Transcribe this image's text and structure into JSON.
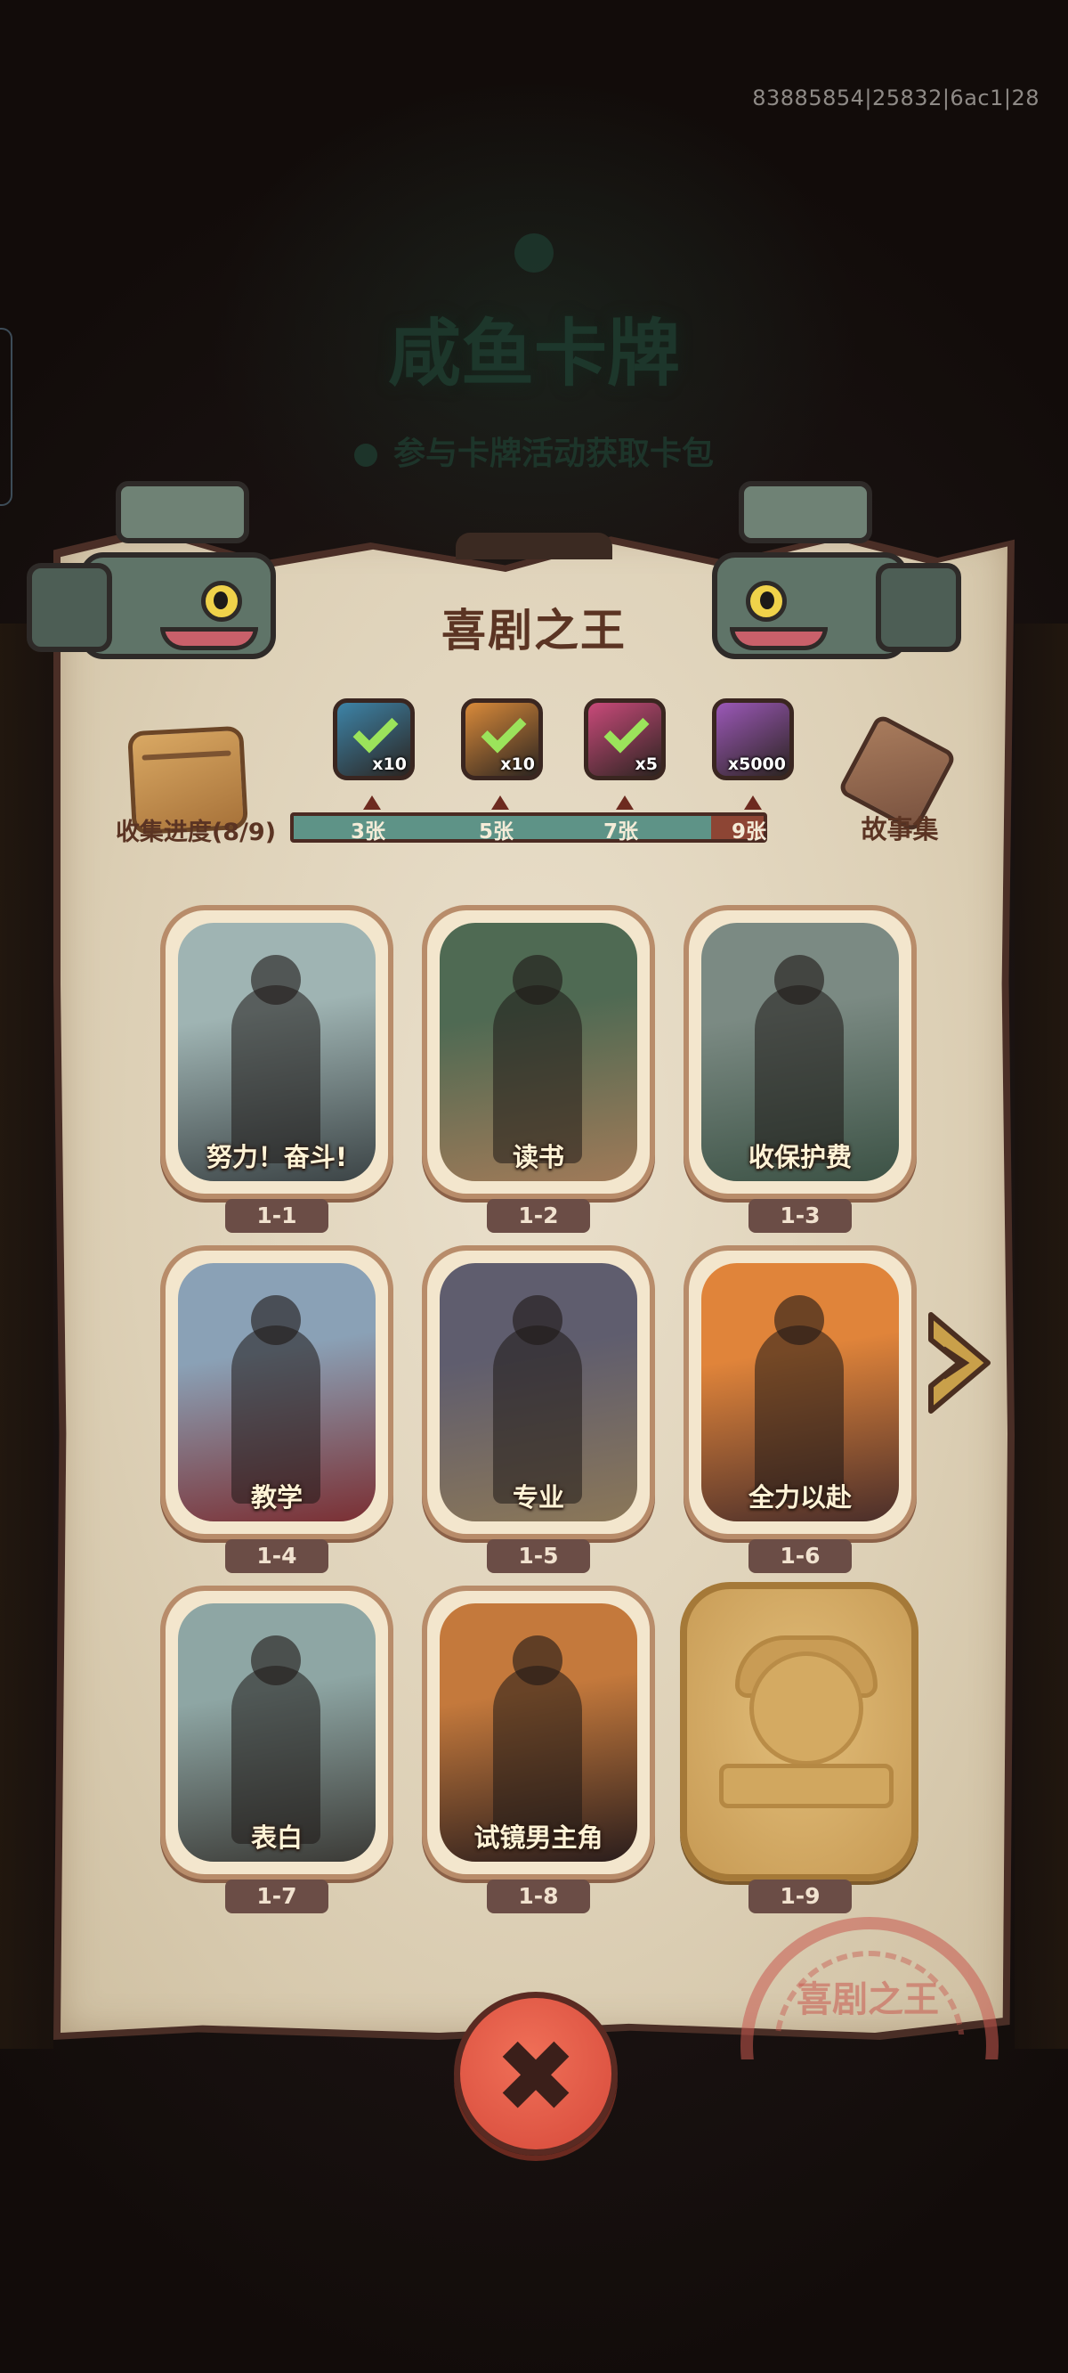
{
  "watermark": "83885854|25832|6ac1|28",
  "background": {
    "title": "咸鱼卡牌",
    "subtitle": "参与卡牌活动获取卡包"
  },
  "panel": {
    "title": "喜剧之王",
    "collect_label": "收集进度(8/9)",
    "collected": 8,
    "total": 9,
    "story_label": "故事集",
    "stamp_text": "喜剧之王"
  },
  "rewards": [
    {
      "icon": "blue-card-reward-icon",
      "count": "x10",
      "claimed": true,
      "color": "#3d84a8",
      "threshold": "3张"
    },
    {
      "icon": "orange-card-reward-icon",
      "count": "x10",
      "claimed": true,
      "color": "#d98a3a",
      "threshold": "5张"
    },
    {
      "icon": "purple-orb-reward-icon",
      "count": "x5",
      "claimed": true,
      "color": "#c94a7a",
      "threshold": "7张"
    },
    {
      "icon": "crystal-reward-icon",
      "count": "x5000",
      "claimed": false,
      "color": "#9b58b8",
      "threshold": "9张"
    }
  ],
  "cards": [
    {
      "label": "努力！奋斗!",
      "num": "1-1",
      "colors": [
        "#9fb4b3",
        "#3c4446"
      ]
    },
    {
      "label": "读书",
      "num": "1-2",
      "colors": [
        "#4f6a53",
        "#a07a58"
      ]
    },
    {
      "label": "收保护费",
      "num": "1-3",
      "colors": [
        "#7b8a83",
        "#3c5245"
      ]
    },
    {
      "label": "教学",
      "num": "1-4",
      "colors": [
        "#8aa1b6",
        "#7b2f33"
      ]
    },
    {
      "label": "专业",
      "num": "1-5",
      "colors": [
        "#5f5d6e",
        "#8b7758"
      ]
    },
    {
      "label": "全力以赴",
      "num": "1-6",
      "colors": [
        "#e0843a",
        "#4a2e2a"
      ]
    },
    {
      "label": "表白",
      "num": "1-7",
      "colors": [
        "#8ea6a4",
        "#3b3a36"
      ]
    },
    {
      "label": "试镜男主角",
      "num": "1-8",
      "colors": [
        "#c4793c",
        "#2a1d1c"
      ]
    },
    {
      "label": "",
      "num": "1-9",
      "locked": true
    }
  ],
  "colors": {
    "accent_title": "#5b3423",
    "progress_fill": "#5e9387",
    "progress_track": "#8d4534",
    "close_button": "#e35a45"
  }
}
